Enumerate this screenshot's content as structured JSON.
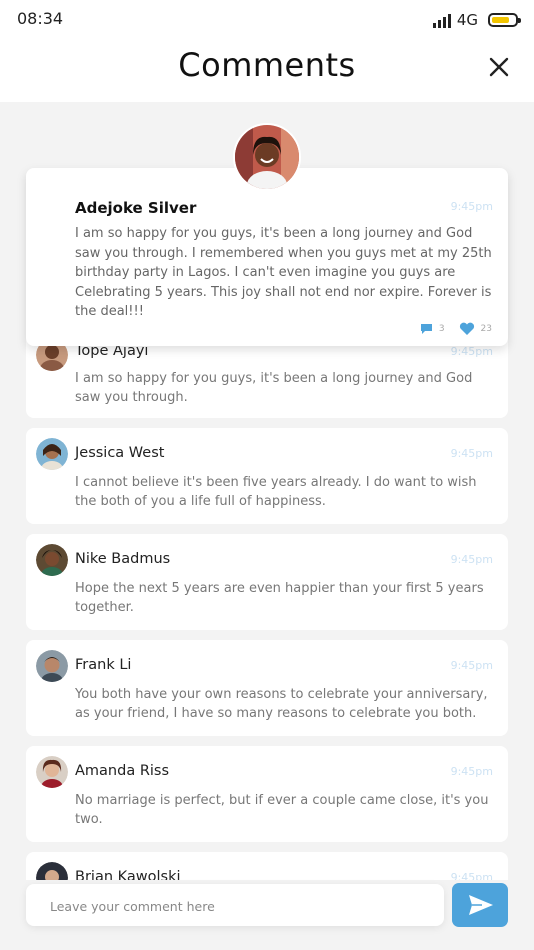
{
  "status_bar": {
    "time": "08:34",
    "network": "4G",
    "battery_level": 0.75
  },
  "header": {
    "title": "Comments"
  },
  "featured": {
    "name": "Adejoke Silver",
    "time": "9:45pm",
    "text": "I am so happy for you guys, it's been a long journey and God saw you through. I remembered when you guys met  at my 25th birthday party in Lagos. I can't even imagine  you guys are Celebrating 5 years. This joy shall  not end nor expire. Forever is the deal!!!",
    "comment_count": "3",
    "like_count": "23"
  },
  "comments": [
    {
      "name": "Tope Ajayi",
      "time": "9:45pm",
      "text": "I am so happy for you guys, it's been a long journey and God saw you through."
    },
    {
      "name": "Jessica West",
      "time": "9:45pm",
      "text": "I cannot believe it's been five years already. I do want to wish the both of you a life full of happiness."
    },
    {
      "name": "Nike Badmus",
      "time": "9:45pm",
      "text": "Hope the next 5 years are even happier than your first 5 years together."
    },
    {
      "name": "Frank Li",
      "time": "9:45pm",
      "text": "You both have your own reasons to celebrate your anniversary, as your friend, I have so many reasons to celebrate you both."
    },
    {
      "name": "Amanda Riss",
      "time": "9:45pm",
      "text": "No marriage is perfect, but if ever a couple came close, it's you two."
    },
    {
      "name": "Brian Kawolski",
      "time": "9:45pm",
      "text": ""
    }
  ],
  "composer": {
    "placeholder": "Leave your comment here"
  },
  "colors": {
    "accent": "#4da3db",
    "battery": "#f2c500",
    "time_text": "#cde2f3"
  }
}
